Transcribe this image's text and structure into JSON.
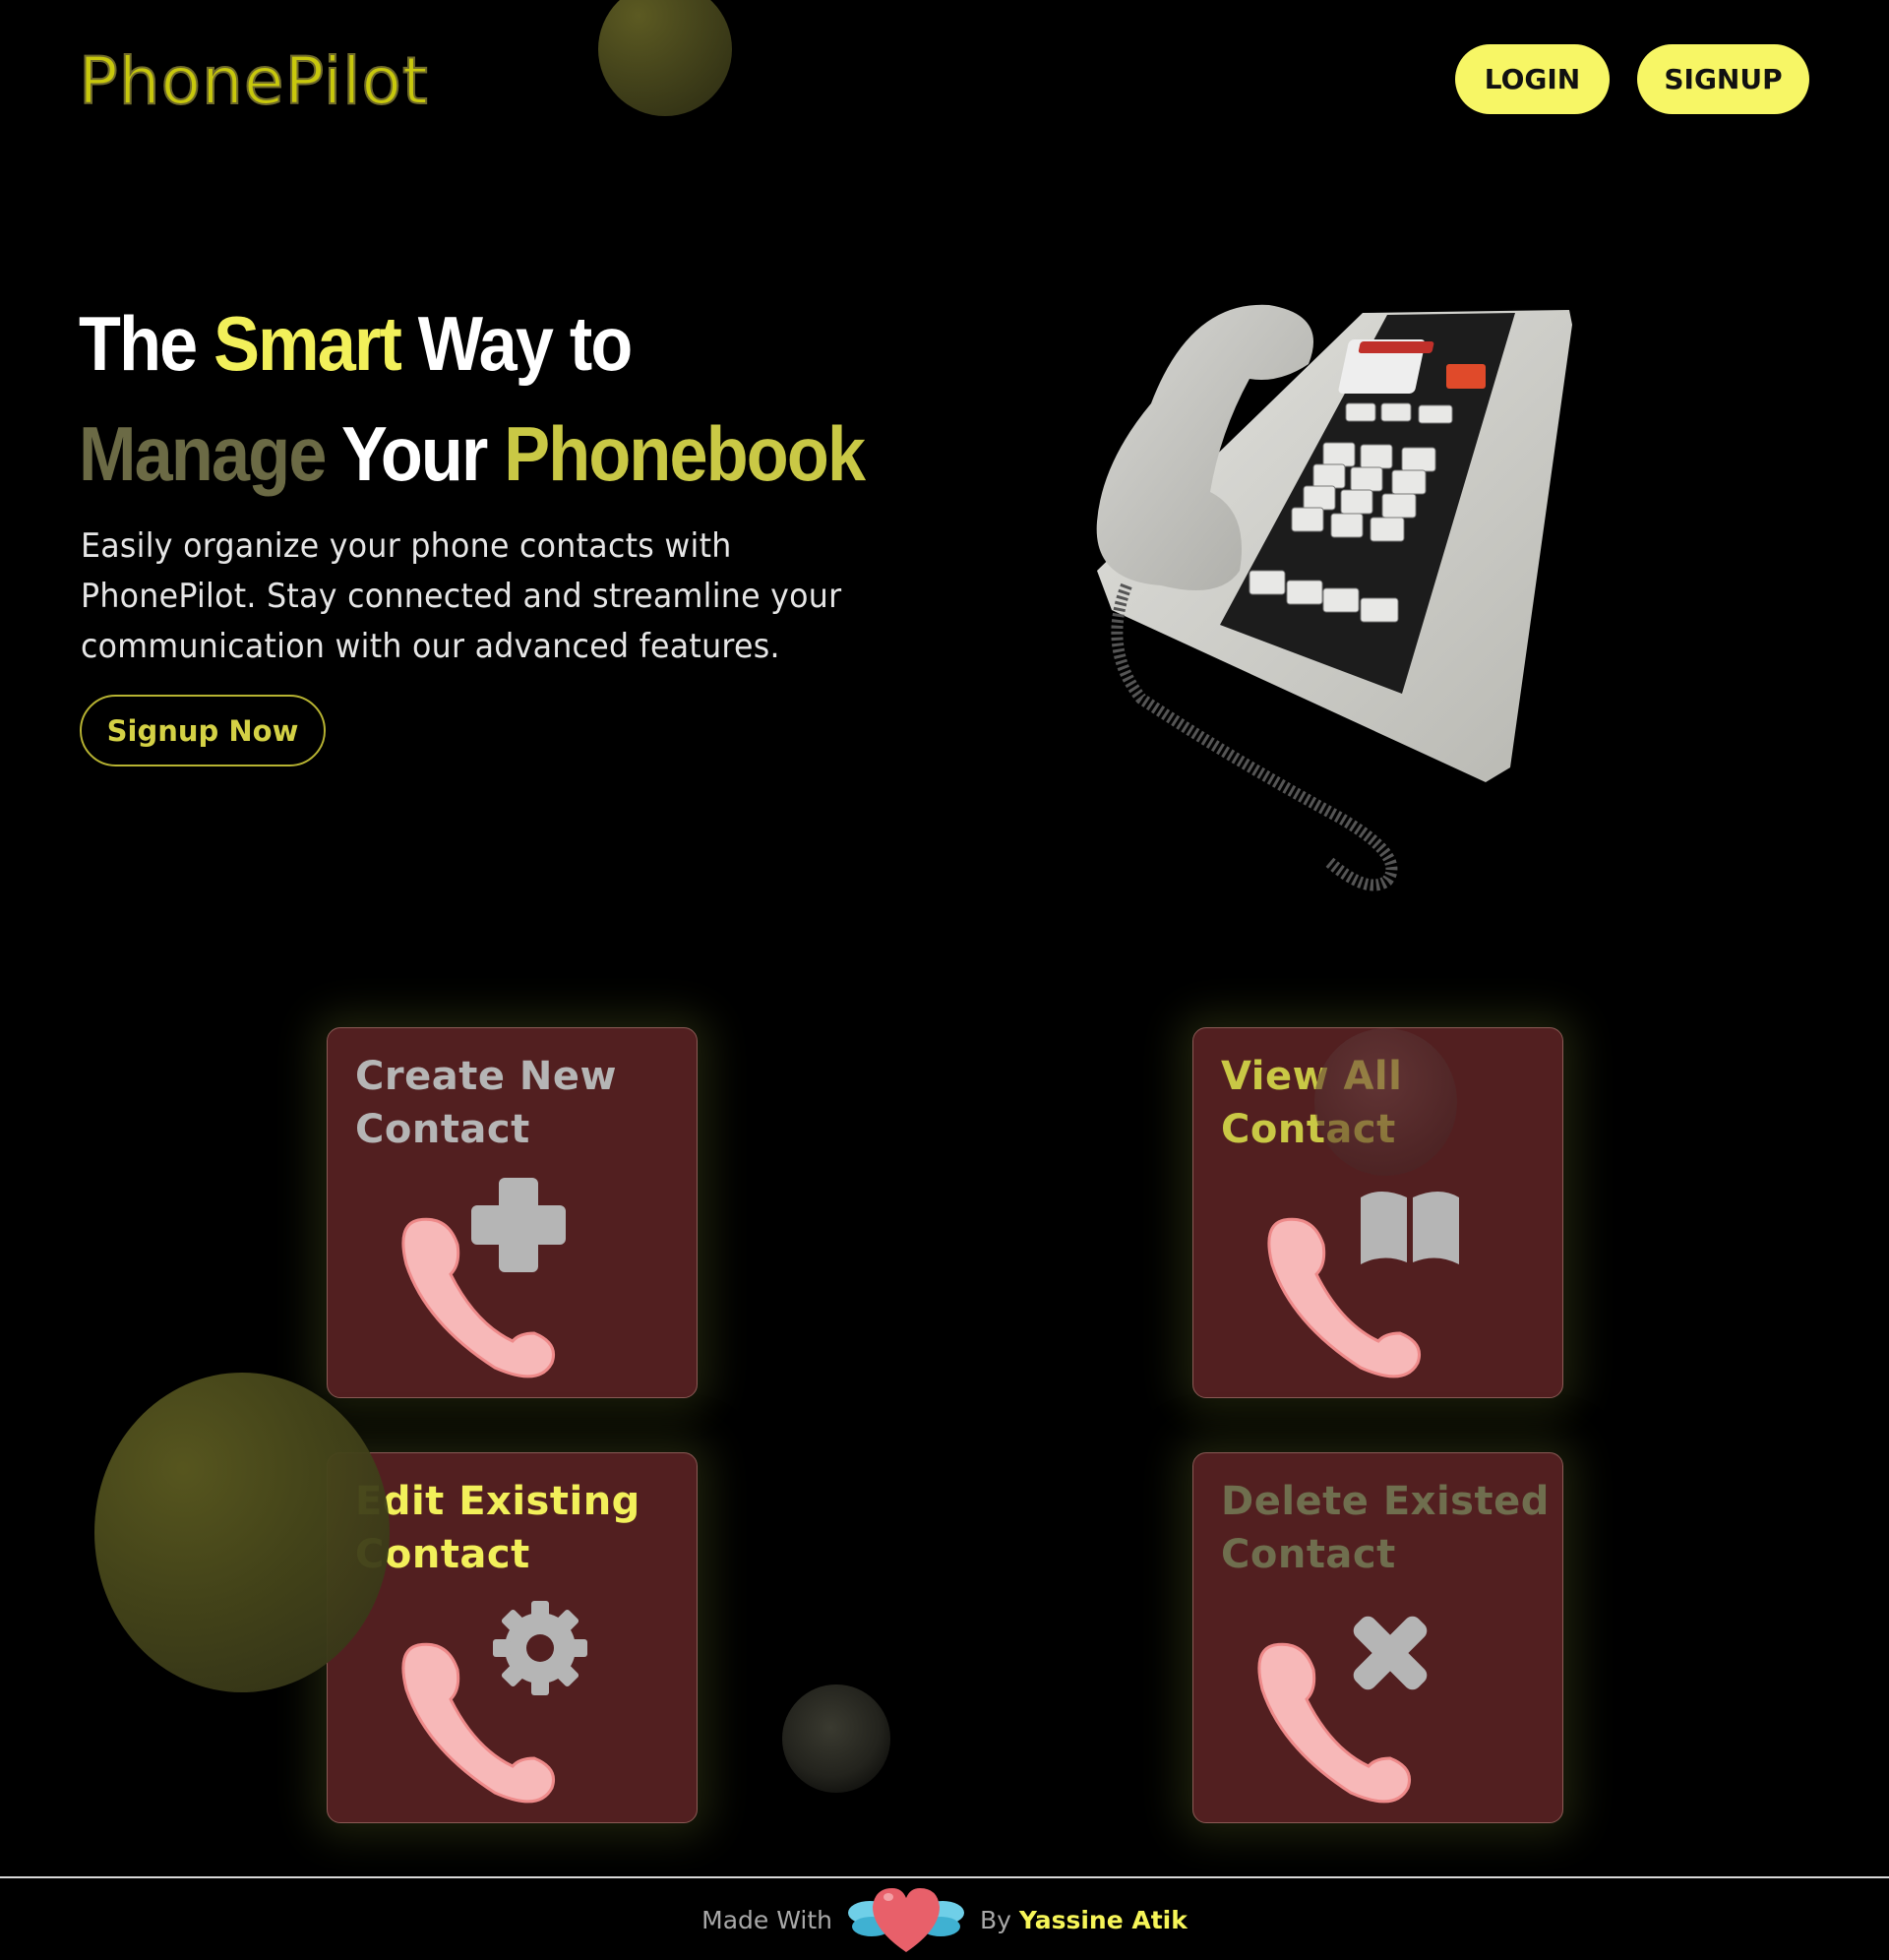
{
  "header": {
    "logo": "PhonePilot",
    "login_label": "LOGIN",
    "signup_label": "SIGNUP"
  },
  "hero": {
    "title_line1": [
      {
        "text": "The",
        "tone": "white"
      },
      {
        "text": "Smart",
        "tone": "yellow"
      },
      {
        "text": "Way to",
        "tone": "white"
      }
    ],
    "title_line2": [
      {
        "text": "Manage",
        "tone": "olive"
      },
      {
        "text": "Your",
        "tone": "white"
      },
      {
        "text": "Phonebook",
        "tone": "gold"
      }
    ],
    "description": "Easily organize your phone contacts with PhonePilot. Stay connected and streamline your communication with our advanced features.",
    "cta_label": "Signup Now",
    "image_icon": "desk-telephone-illustration"
  },
  "cards": [
    {
      "title": "Create New Contact",
      "title_color": "#b5b5b5",
      "icon": "plus-icon"
    },
    {
      "title": "View All Contact",
      "title_color": "#c9c845",
      "icon": "book-icon"
    },
    {
      "title": "Edit Existing Contact",
      "title_color": "#f2f05a",
      "icon": "gear-icon"
    },
    {
      "title": "Delete Existed Contact",
      "title_color": "#6f6e4e",
      "icon": "x-icon"
    }
  ],
  "footer": {
    "made_with": "Made With",
    "heart_icon": "winged-heart-icon",
    "by": "By",
    "author": "Yassine Atik"
  },
  "colors": {
    "accent_yellow": "#f7f665",
    "card_bg": "#521f20",
    "logo": "#c8c80c"
  }
}
